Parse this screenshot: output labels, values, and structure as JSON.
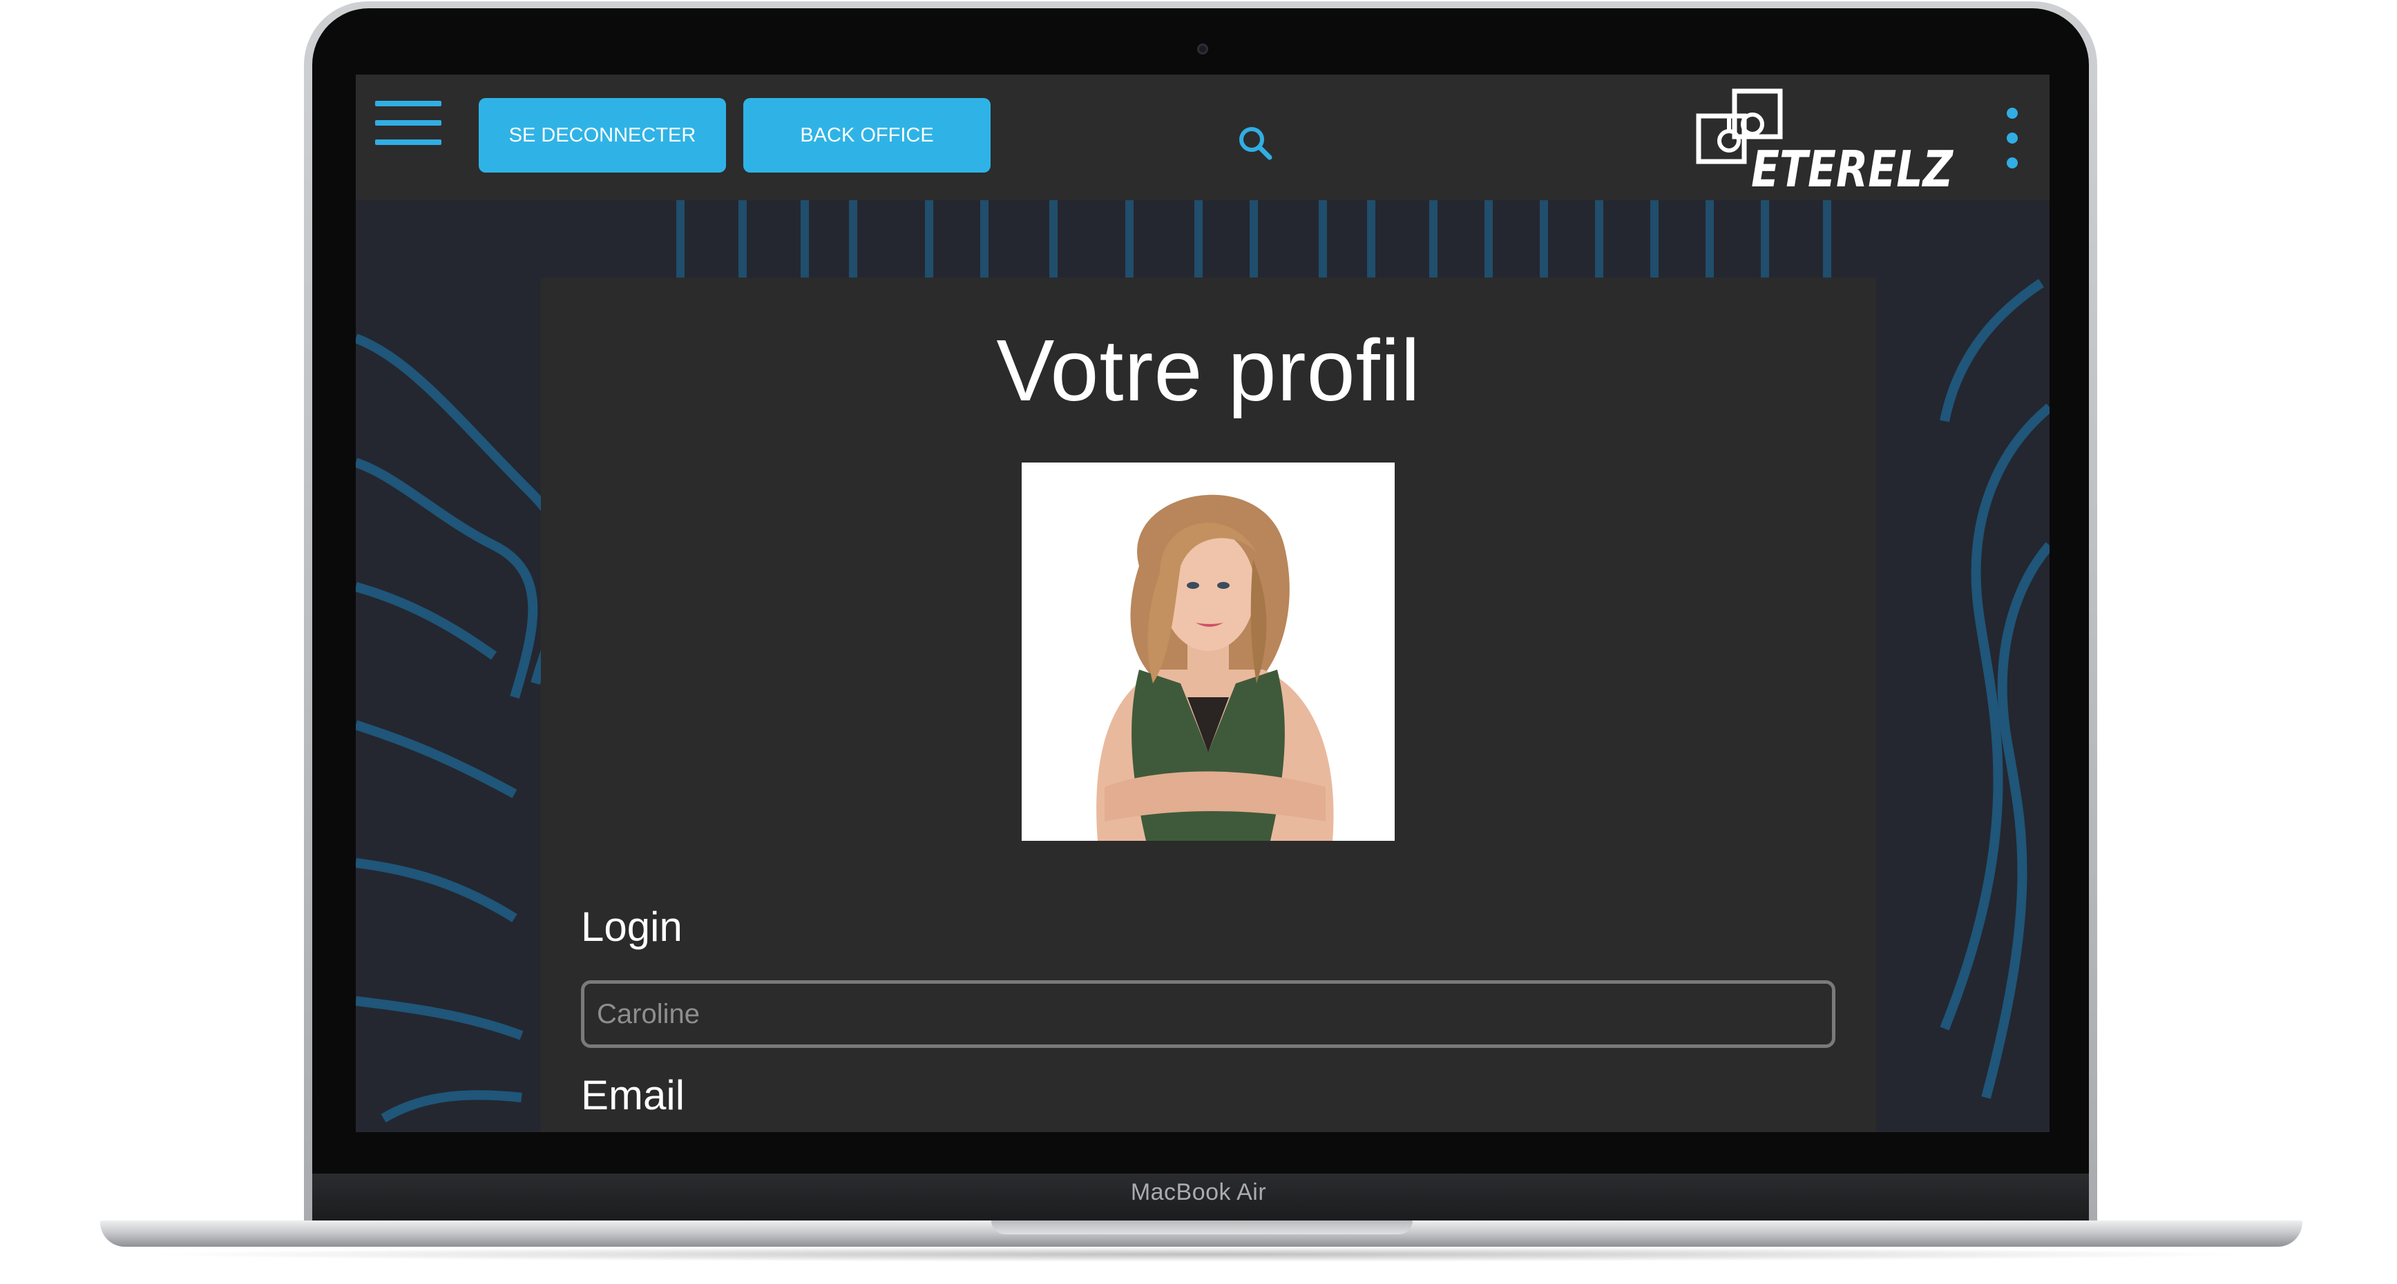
{
  "device": {
    "label": "MacBook Air"
  },
  "header": {
    "menu_icon": "hamburger-icon",
    "logout_label": "SE DECONNECTER",
    "backoffice_label": "BACK OFFICE",
    "search_icon": "search-icon",
    "logo_text": "ETERELZ",
    "more_icon": "vertical-dots-icon",
    "accent_color": "#2fb3e6"
  },
  "profile": {
    "title": "Votre profil",
    "photo_icon": "profile-photo",
    "login_label": "Login",
    "login_placeholder": "Caroline",
    "email_label": "Email"
  },
  "colors": {
    "background": "#24262e",
    "card": "#2b2b2b",
    "topbar": "#2c2c2c"
  }
}
